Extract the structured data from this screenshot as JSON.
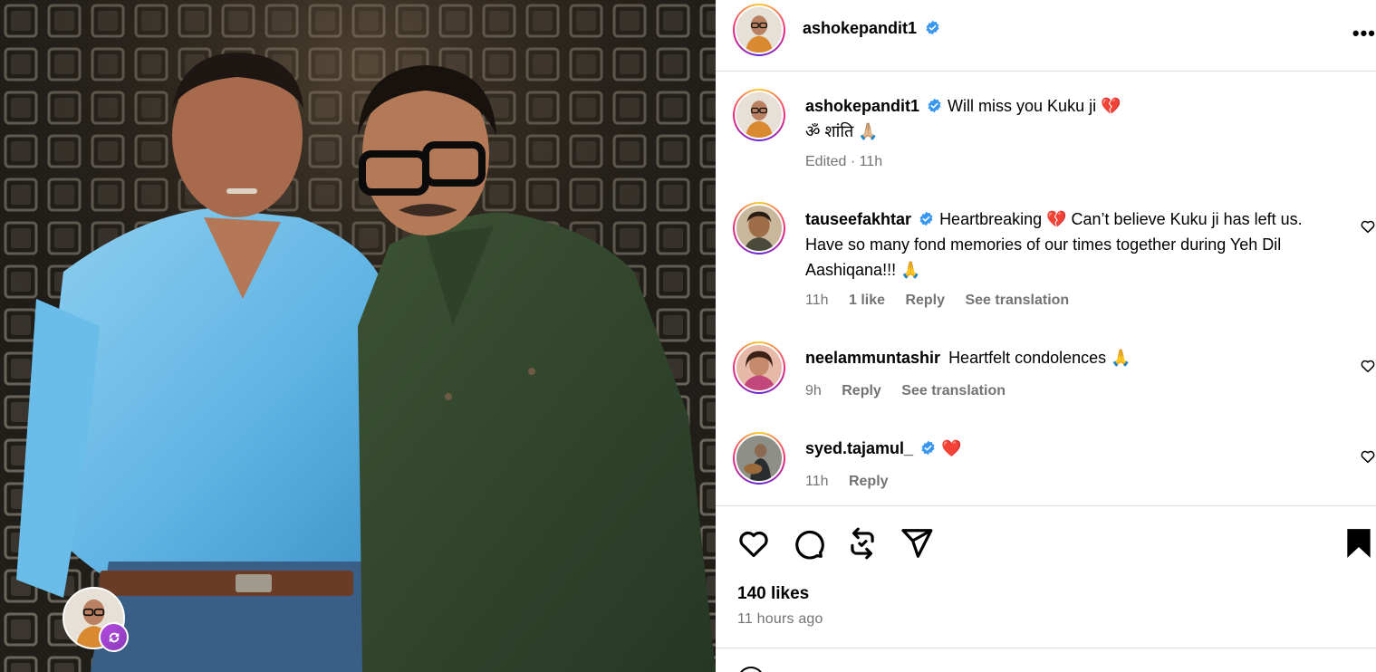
{
  "post": {
    "author": "ashokepandit1",
    "more_label": "•••"
  },
  "caption": {
    "username": "ashokepandit1",
    "line1": "Will miss you Kuku ji 💔",
    "line2": "ॐ शांति 🙏🏼",
    "meta_edited": "Edited · 11h"
  },
  "comments": [
    {
      "username": "tauseefakhtar",
      "verified": true,
      "text": "Heartbreaking 💔 Can’t believe Kuku ji has left us. Have so many fond memories of our times together during Yeh Dil Aashiqana!!! 🙏",
      "time": "11h",
      "likes": "1 like",
      "reply": "Reply",
      "translate": "See translation"
    },
    {
      "username": "neelammuntashir",
      "verified": false,
      "text": "Heartfelt condolences 🙏",
      "time": "9h",
      "reply": "Reply",
      "translate": "See translation"
    },
    {
      "username": "syed.tajamul_",
      "verified": true,
      "text": "❤️",
      "time": "11h",
      "reply": "Reply"
    }
  ],
  "stats": {
    "likes": "140 likes",
    "posted": "11 hours ago"
  },
  "icons": {
    "like": "heart-icon",
    "comment": "comment-icon",
    "repost": "repost-icon",
    "share": "share-icon",
    "save": "bookmark-icon"
  },
  "colors": {
    "text": "#000000",
    "muted": "#737373",
    "verified": "#3897f0",
    "divider": "#dbdbdb"
  }
}
